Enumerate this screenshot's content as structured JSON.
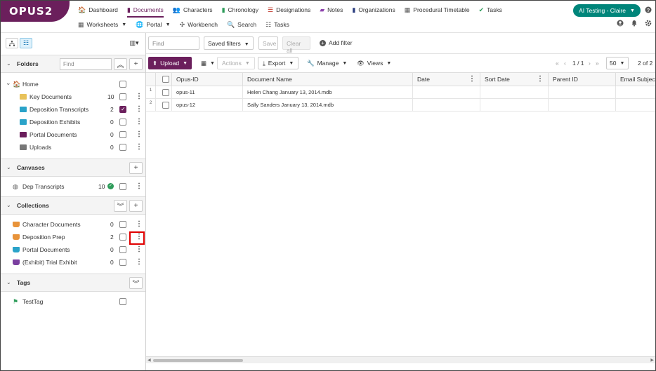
{
  "app": {
    "logo_text": "OPUS2"
  },
  "nav_row1": [
    {
      "label": "Dashboard",
      "icon": "🏠",
      "color": "#555",
      "active": false
    },
    {
      "label": "Documents",
      "icon": "▮",
      "color": "#6b1f5c",
      "active": true
    },
    {
      "label": "Characters",
      "icon": "👥",
      "color": "#e08a00",
      "active": false
    },
    {
      "label": "Chronology",
      "icon": "▮",
      "color": "#2e9c5a",
      "active": false
    },
    {
      "label": "Designations",
      "icon": "☰",
      "color": "#c0392b",
      "active": false
    },
    {
      "label": "Notes",
      "icon": "▰",
      "color": "#8e44ad",
      "active": false
    },
    {
      "label": "Organizations",
      "icon": "▮",
      "color": "#2c3e80",
      "active": false
    },
    {
      "label": "Procedural Timetable",
      "icon": "▦",
      "color": "#555",
      "active": false
    },
    {
      "label": "Tasks",
      "icon": "✔",
      "color": "#2e9c5a",
      "active": false
    }
  ],
  "nav_row2": [
    {
      "label": "Worksheets",
      "icon": "▦",
      "caret": true
    },
    {
      "label": "Portal",
      "icon": "🌐",
      "caret": true
    },
    {
      "label": "Workbench",
      "icon": "✣",
      "caret": false
    },
    {
      "label": "Search",
      "icon": "🔍",
      "caret": false
    },
    {
      "label": "Tasks",
      "icon": "☷",
      "caret": false
    }
  ],
  "user_menu": {
    "label": "AI Testing - Claire"
  },
  "top_icons": {
    "help": "help-icon",
    "account": "account-icon",
    "notifications": "bell-icon",
    "settings": "gear-icon"
  },
  "folders": {
    "title": "Folders",
    "find_placeholder": "Find",
    "items": [
      {
        "label": "Home",
        "count": "",
        "checked": false,
        "level": 0,
        "icon": "home-icon"
      },
      {
        "label": "Key Documents",
        "count": "10",
        "checked": false,
        "level": 1,
        "color": "#e8c25a"
      },
      {
        "label": "Deposition Transcripts",
        "count": "2",
        "checked": true,
        "level": 1,
        "color": "#2aa3c9"
      },
      {
        "label": "Deposition Exhibits",
        "count": "0",
        "checked": false,
        "level": 1,
        "color": "#2aa3c9"
      },
      {
        "label": "Portal Documents",
        "count": "0",
        "checked": false,
        "level": 1,
        "color": "#6b1f5c"
      },
      {
        "label": "Uploads",
        "count": "0",
        "checked": false,
        "level": 1,
        "color": "#777"
      }
    ]
  },
  "canvases": {
    "title": "Canvases",
    "items": [
      {
        "label": "Dep Transcripts",
        "count": "10"
      }
    ]
  },
  "collections": {
    "title": "Collections",
    "items": [
      {
        "label": "Character Documents",
        "count": "0",
        "color": "#e8933a"
      },
      {
        "label": "Deposition Prep",
        "count": "2",
        "color": "#e8933a"
      },
      {
        "label": "Portal Documents",
        "count": "0",
        "color": "#2aa3c9"
      },
      {
        "label": "(Exhibit) Trial Exhibit",
        "count": "0",
        "color": "#7b3fa0"
      }
    ]
  },
  "tags": {
    "title": "Tags",
    "items": [
      {
        "label": "TestTag"
      }
    ]
  },
  "filterbar": {
    "find_placeholder": "Find",
    "saved_filters": "Saved filters",
    "save": "Save",
    "clear_all": "Clear all",
    "add_filter": "Add filter"
  },
  "toolbar": {
    "upload": "Upload",
    "actions": "Actions",
    "export": "Export",
    "manage": "Manage",
    "views": "Views",
    "page": "1 / 1",
    "page_size": "50",
    "total": "2 of 2"
  },
  "grid": {
    "columns": [
      "Opus-ID",
      "Document Name",
      "Date",
      "Sort Date",
      "Parent ID",
      "Email Subject"
    ],
    "rows": [
      {
        "num": "1",
        "opus_id": "opus-11",
        "name": "Helen Chang January 13, 2014.mdb"
      },
      {
        "num": "2",
        "opus_id": "opus-12",
        "name": "Sally Sanders January 13, 2014.mdb"
      }
    ]
  }
}
